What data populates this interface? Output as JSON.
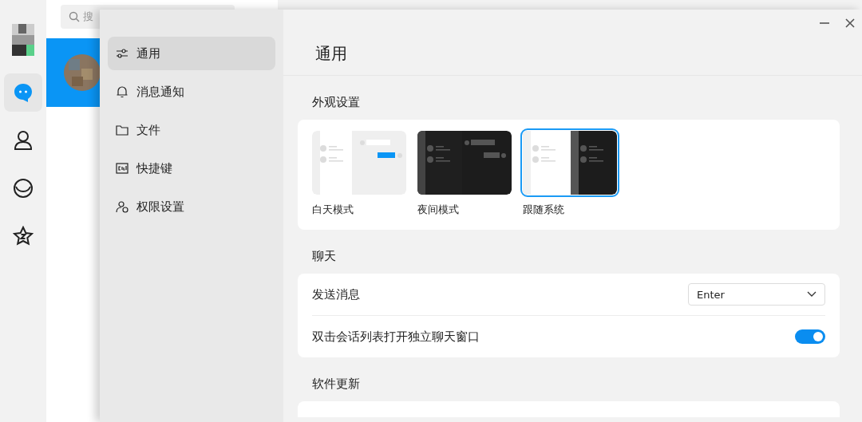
{
  "rail": {
    "items": [
      {
        "kind": "chat",
        "selected": true
      },
      {
        "kind": "contacts",
        "selected": false
      },
      {
        "kind": "moments",
        "selected": false
      },
      {
        "kind": "favorites",
        "selected": false
      }
    ]
  },
  "chat_list": {
    "search": {
      "placeholder": "搜"
    },
    "rows": [
      {
        "selected": true
      }
    ]
  },
  "settings": {
    "sidebar": {
      "items": [
        {
          "kind": "sliders",
          "label": "通用",
          "selected": true
        },
        {
          "kind": "bell",
          "label": "消息通知",
          "selected": false
        },
        {
          "kind": "folder",
          "label": "文件",
          "selected": false
        },
        {
          "kind": "keyboard",
          "label": "快捷键",
          "selected": false
        },
        {
          "kind": "permission",
          "label": "权限设置",
          "selected": false
        }
      ]
    },
    "title": "通用",
    "appearance": {
      "heading": "外观设置",
      "themes": [
        {
          "kind": "light",
          "label": "白天模式",
          "selected": false
        },
        {
          "kind": "dark",
          "label": "夜间模式",
          "selected": false
        },
        {
          "kind": "system",
          "label": "跟随系统",
          "selected": true
        }
      ]
    },
    "chat": {
      "heading": "聊天",
      "send": {
        "label": "发送消息",
        "value": "Enter"
      },
      "toggle": {
        "label": "双击会话列表打开独立聊天窗口",
        "on": true
      }
    },
    "update": {
      "heading": "软件更新"
    }
  }
}
